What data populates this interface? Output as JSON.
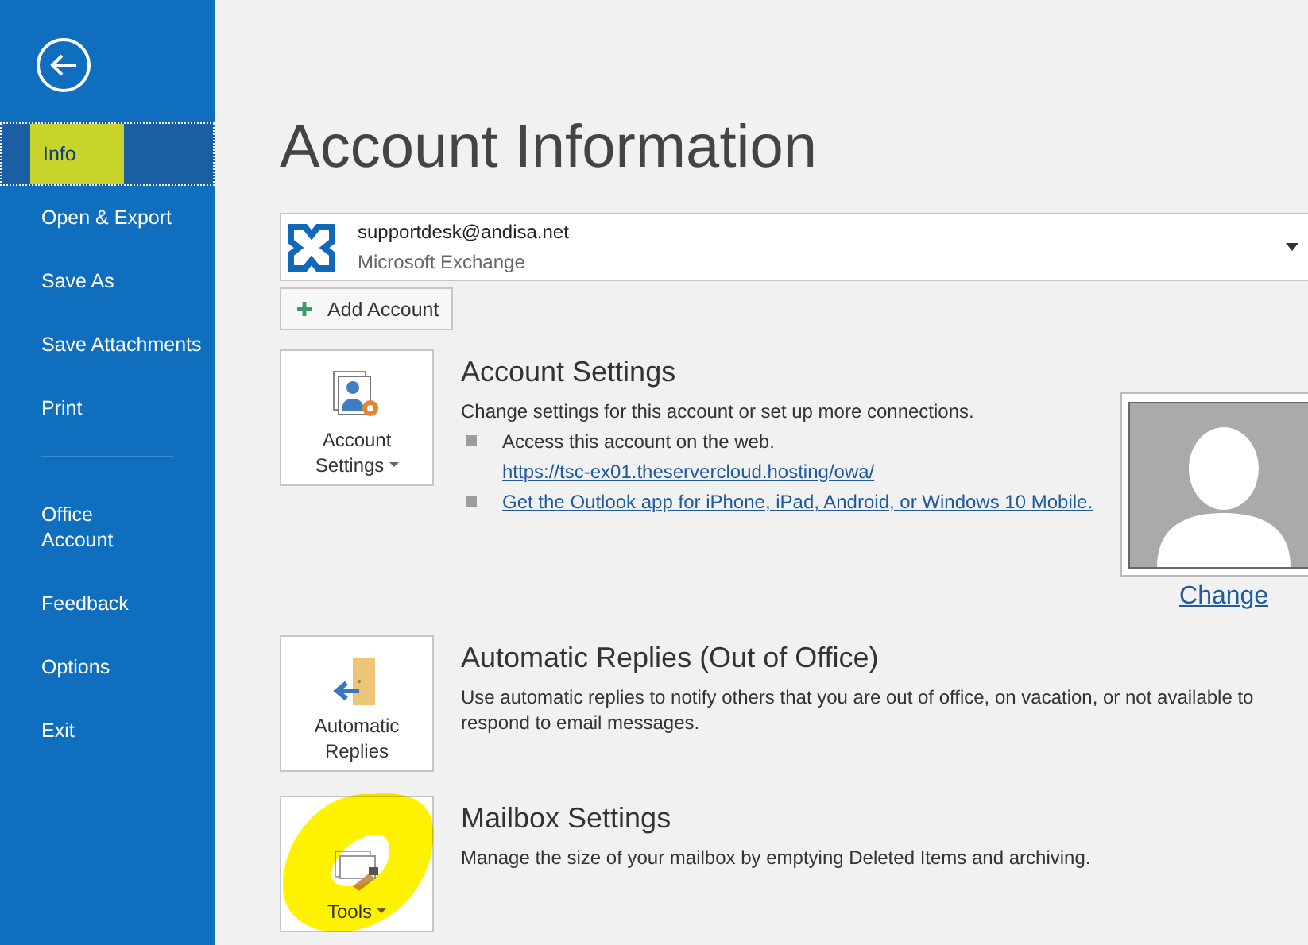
{
  "sidebar": {
    "primary_items": [
      {
        "label": "Info",
        "selected": true,
        "highlighted": true
      },
      {
        "label": "Open & Export",
        "selected": false,
        "highlighted": false
      },
      {
        "label": "Save As",
        "selected": false,
        "highlighted": false
      },
      {
        "label": "Save Attachments",
        "selected": false,
        "highlighted": false
      },
      {
        "label": "Print",
        "selected": false,
        "highlighted": false
      }
    ],
    "secondary_items": [
      {
        "label": "Office\nAccount",
        "selected": false,
        "highlighted": false
      },
      {
        "label": "Feedback",
        "selected": false,
        "highlighted": false
      },
      {
        "label": "Options",
        "selected": false,
        "highlighted": false
      },
      {
        "label": "Exit",
        "selected": false,
        "highlighted": false
      }
    ]
  },
  "page_title": "Account Information",
  "account_selector": {
    "email": "supportdesk@andisa.net",
    "type": "Microsoft Exchange"
  },
  "add_account_button": "Add Account",
  "sections": [
    {
      "kind": "account_settings",
      "button_label": "Account\nSettings",
      "has_menu": true,
      "highlighted": false,
      "title": "Account Settings",
      "description": "Change settings for this account or set up more connections.",
      "bullets": [
        {
          "text": "Access this account on the web.",
          "link": "https://tsc-ex01.theservercloud.hosting/owa/"
        },
        {
          "link": "Get the Outlook app for iPhone, iPad, Android, or Windows 10 Mobile."
        }
      ],
      "photo_link": "Change"
    },
    {
      "kind": "automatic_replies",
      "button_label": "Automatic\nReplies",
      "has_menu": false,
      "highlighted": false,
      "title": "Automatic Replies (Out of Office)",
      "description": "Use automatic replies to notify others that you are out of office, on vacation, or not available to respond to email messages."
    },
    {
      "kind": "tools",
      "button_label": "Tools",
      "has_menu": true,
      "highlighted": true,
      "title": "Mailbox Settings",
      "description": "Manage the size of your mailbox by emptying Deleted Items and archiving."
    }
  ]
}
